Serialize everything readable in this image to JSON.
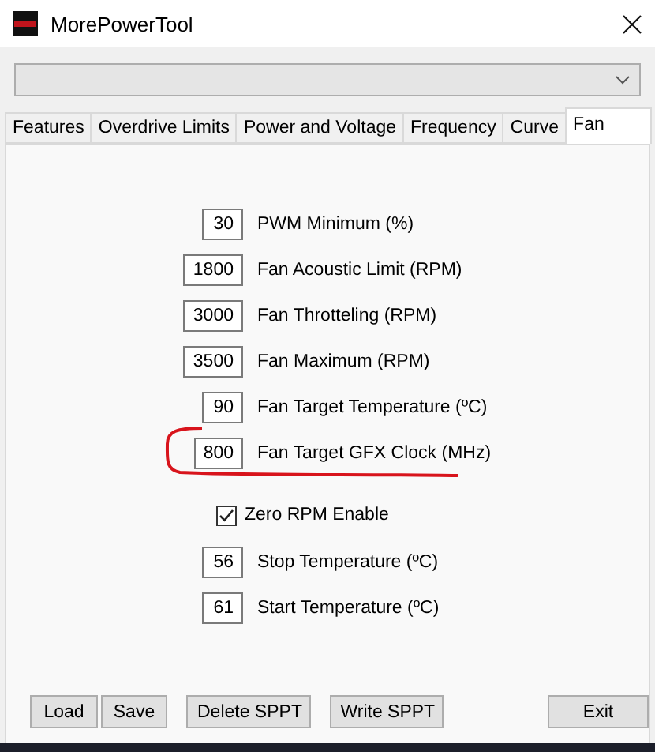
{
  "window": {
    "title": "MorePowerTool"
  },
  "tabs": [
    {
      "label": "Features",
      "selected": false
    },
    {
      "label": "Overdrive Limits",
      "selected": false
    },
    {
      "label": "Power and Voltage",
      "selected": false
    },
    {
      "label": "Frequency",
      "selected": false
    },
    {
      "label": "Curve",
      "selected": false
    },
    {
      "label": "Fan",
      "selected": true
    }
  ],
  "settings": [
    {
      "kind": "number",
      "value": "30",
      "label": "PWM Minimum (%)",
      "highlighted": false
    },
    {
      "kind": "number",
      "value": "1800",
      "label": "Fan Acoustic Limit (RPM)",
      "highlighted": false
    },
    {
      "kind": "number",
      "value": "3000",
      "label": "Fan Throtteling (RPM)",
      "highlighted": false
    },
    {
      "kind": "number",
      "value": "3500",
      "label": "Fan Maximum (RPM)",
      "highlighted": false
    },
    {
      "kind": "number",
      "value": "90",
      "label": "Fan Target Temperature (ºC)",
      "highlighted": false
    },
    {
      "kind": "number",
      "value": "800",
      "label": "Fan Target GFX Clock (MHz)",
      "highlighted": true
    },
    {
      "kind": "checkbox",
      "label": "Zero RPM Enable",
      "checked": true
    },
    {
      "kind": "number",
      "value": "56",
      "label": "Stop Temperature (ºC)",
      "highlighted": false
    },
    {
      "kind": "number",
      "value": "61",
      "label": "Start Temperature (ºC)",
      "highlighted": false
    }
  ],
  "buttons": [
    "Load",
    "Save",
    "Delete SPPT",
    "Write SPPT",
    "Exit"
  ]
}
